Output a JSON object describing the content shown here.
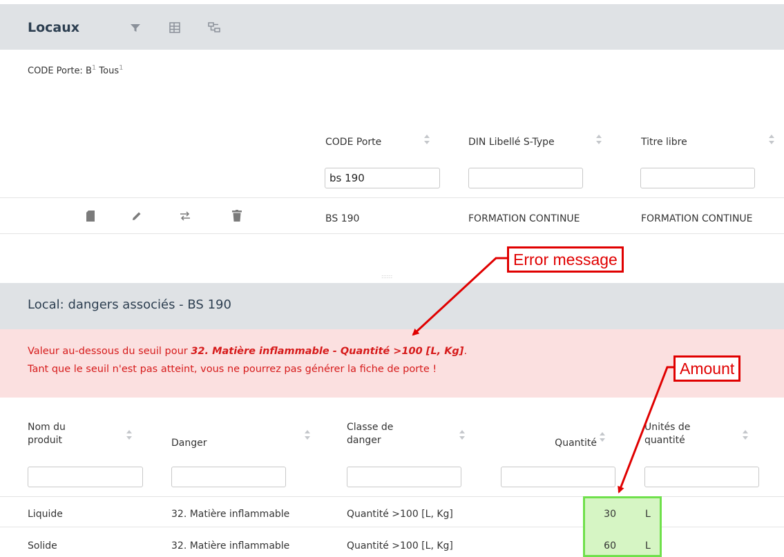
{
  "panel1": {
    "title": "Locaux",
    "icons": [
      "filter-icon",
      "excel-icon",
      "hierarchy-icon"
    ],
    "filter": {
      "label": "CODE Porte:",
      "value": "B",
      "value_count": "1",
      "all": "Tous",
      "all_count": "1"
    },
    "columns": [
      "CODE Porte",
      "DIN Libellé S-Type",
      "Titre libre"
    ],
    "filters": [
      "bs 190",
      "",
      ""
    ],
    "rows": [
      {
        "code": "BS 190",
        "din": "FORMATION CONTINUE",
        "titre": "FORMATION CONTINUE"
      }
    ],
    "row_icons": [
      "document-icon",
      "edit-icon",
      "swap-icon",
      "trash-icon"
    ]
  },
  "splitter": "::::::",
  "panel2": {
    "title": "Local: dangers associés - BS 190",
    "alert": {
      "line1_prefix": "Valeur au-dessous du seuil pour ",
      "line1_bold": "32. Matière inflammable - Quantité >100 [L, Kg]",
      "line1_suffix": ".",
      "line2": "Tant que le seuil n'est pas atteint, vous ne pourrez pas générer la fiche de porte !"
    },
    "columns": [
      {
        "l1": "Nom du",
        "l2": "produit"
      },
      {
        "l1": "",
        "l2": "Danger"
      },
      {
        "l1": "Classe de",
        "l2": "danger"
      },
      {
        "l1": "",
        "l2": "Quantité"
      },
      {
        "l1": "Unités de",
        "l2": "quantité"
      }
    ],
    "rows": [
      {
        "nom": "Liquide",
        "danger": "32. Matière inflammable",
        "classe": "Quantité >100 [L, Kg]",
        "quantite": "30",
        "unite": "L"
      },
      {
        "nom": "Solide",
        "danger": "32. Matière inflammable",
        "classe": "Quantité >100 [L, Kg]",
        "quantite": "60",
        "unite": "L"
      }
    ]
  },
  "annotations": {
    "error": "Error message",
    "amount": "Amount"
  },
  "colors": {
    "alert_text": "#d61a1a",
    "alert_bg": "#fbe0e0",
    "callout": "#e00000",
    "highlight": "#6fe04b",
    "header_bg": "#dfe2e5"
  }
}
